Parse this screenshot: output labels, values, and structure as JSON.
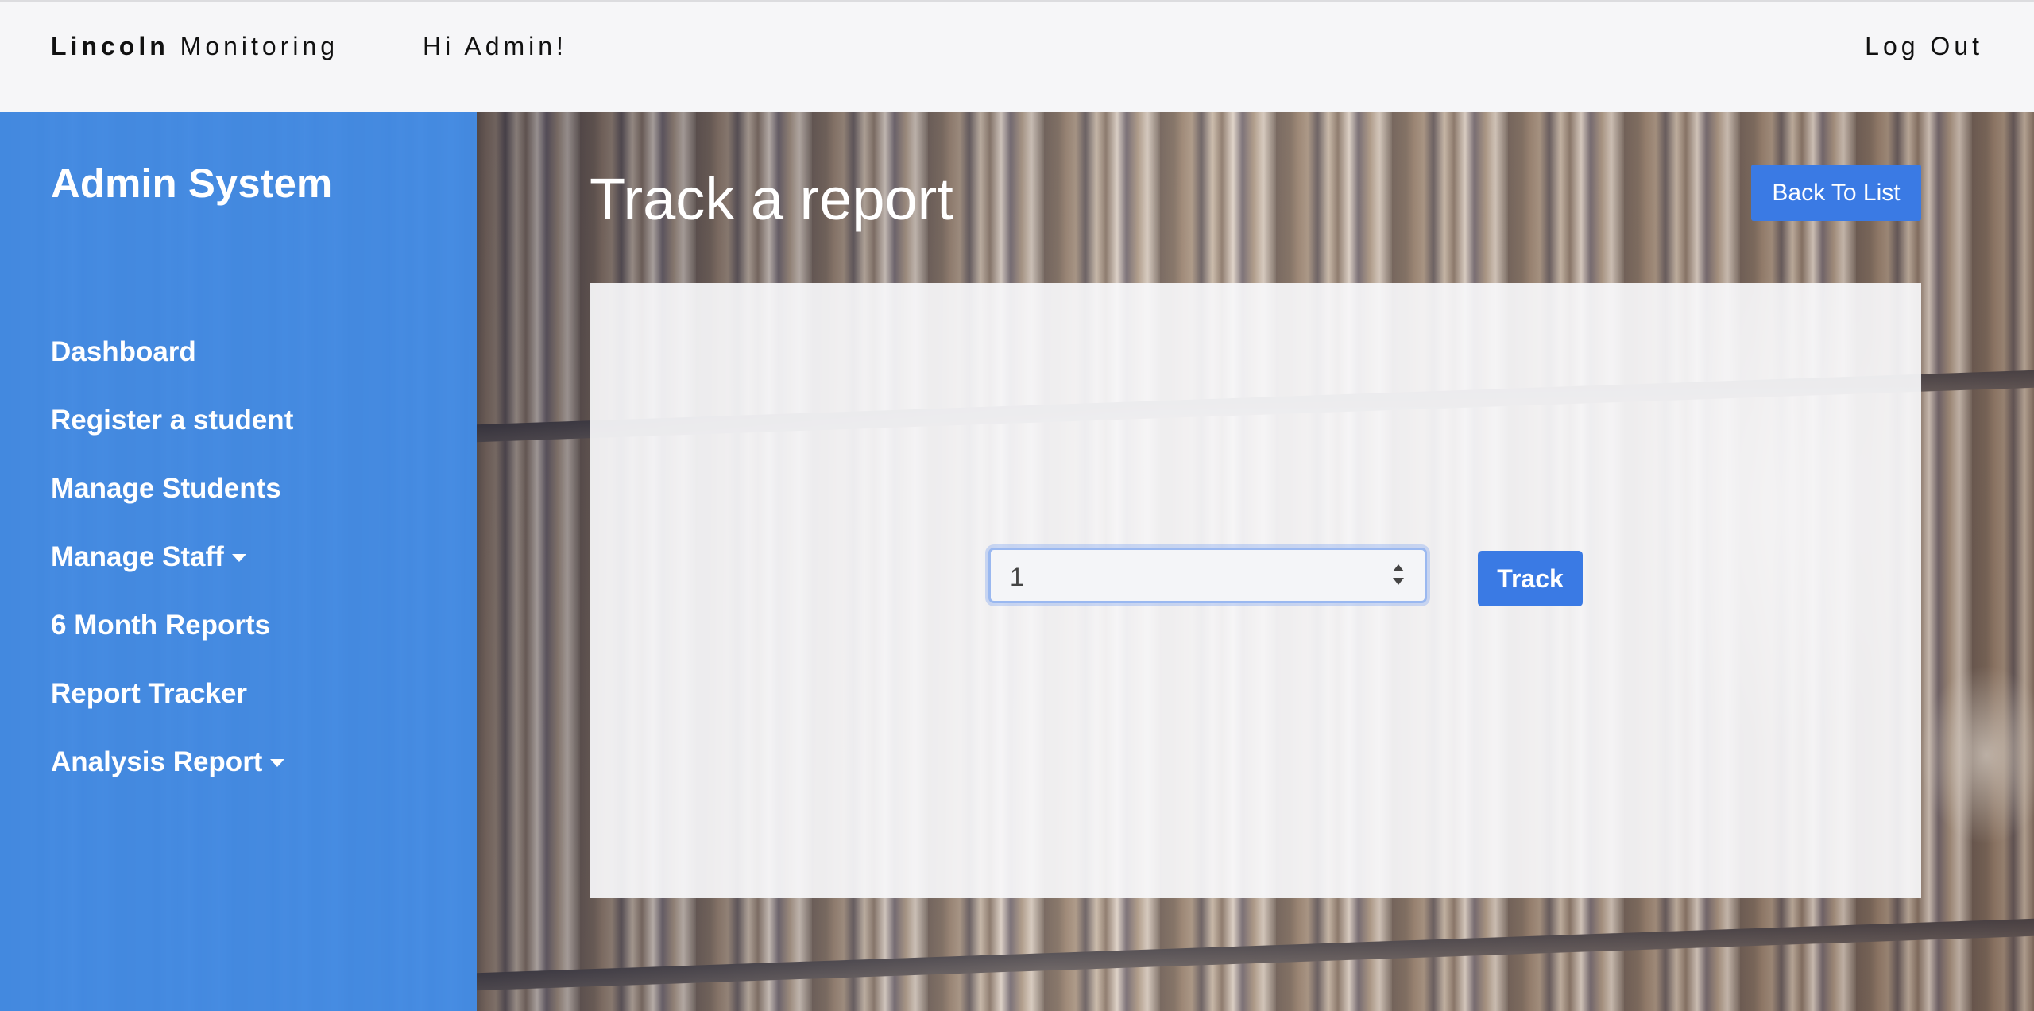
{
  "header": {
    "brand_bold": "Lincoln",
    "brand_rest": "Monitoring",
    "greeting": "Hi Admin!",
    "logout_label": "Log Out"
  },
  "sidebar": {
    "title": "Admin System",
    "items": [
      {
        "label": "Dashboard",
        "dropdown": false
      },
      {
        "label": "Register a student",
        "dropdown": false
      },
      {
        "label": "Manage Students",
        "dropdown": false
      },
      {
        "label": "Manage Staff",
        "dropdown": true
      },
      {
        "label": "6 Month Reports",
        "dropdown": false
      },
      {
        "label": "Report Tracker",
        "dropdown": false
      },
      {
        "label": "Analysis Report",
        "dropdown": true
      }
    ]
  },
  "main": {
    "title": "Track a report",
    "back_label": "Back To List",
    "report_number_value": "1",
    "track_label": "Track"
  },
  "colors": {
    "accent": "#3a7ae4",
    "sidebar": "#448ce6"
  }
}
